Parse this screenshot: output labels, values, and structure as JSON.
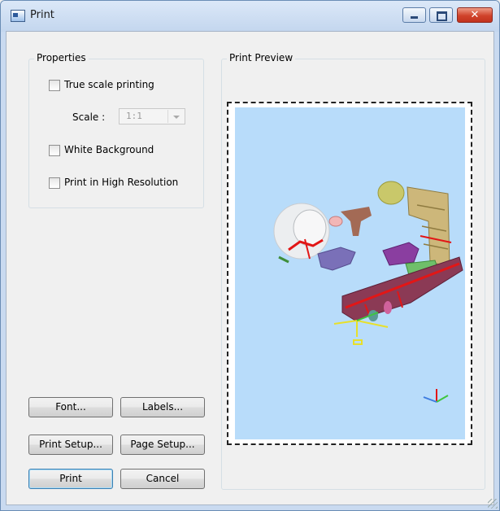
{
  "window": {
    "title": "Print",
    "controls": {
      "minimize": "minimize",
      "maximize": "maximize",
      "close": "✕"
    }
  },
  "properties": {
    "group_label": "Properties",
    "true_scale": {
      "label": "True scale printing",
      "checked": false
    },
    "scale": {
      "label": "Scale :",
      "value": "1:1"
    },
    "white_background": {
      "label": "White Background",
      "checked": false
    },
    "high_resolution": {
      "label": "Print in High Resolution",
      "checked": false
    }
  },
  "preview": {
    "group_label": "Print Preview",
    "background_color": "#b8dcfa"
  },
  "buttons": {
    "font": "Font...",
    "labels": "Labels...",
    "print_setup": "Print Setup...",
    "page_setup": "Page Setup...",
    "print": "Print",
    "cancel": "Cancel"
  }
}
